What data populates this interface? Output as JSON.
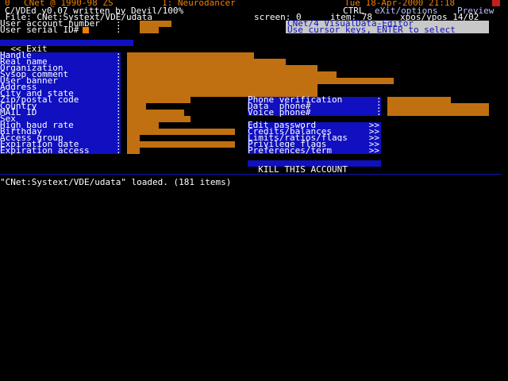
{
  "titlebar": {
    "port": "0",
    "system": "CNet @ 1990-98 ZS",
    "node": "1: Neurodancer",
    "datetime": "Tue 18-Apr-2000 21:18"
  },
  "header": {
    "line1": "C/VDEd v0.07 written by Devil/100%",
    "ctrl": "CTRL ",
    "exit_opts": "eXit/options ",
    "preview": "Preview",
    "file_line": " File: CNet:Systext/VDE/udata",
    "screen_label": "screen: 0",
    "item_label": "item: 78",
    "pos_label": "xpos/ypos 14/02",
    "help1": "CNet/4 VisualData-Editor",
    "help2": "Use cursor keys, ENTER to select"
  },
  "top_fields": [
    {
      "label": "User account number",
      "colon": ":"
    },
    {
      "label": "User serial ID#",
      "colon": ":"
    }
  ],
  "exit_label": "<< Exit",
  "fields": [
    {
      "label": "Handle",
      "colon": ":"
    },
    {
      "label": "Real name",
      "colon": ":"
    },
    {
      "label": "Organization",
      "colon": ":"
    },
    {
      "label": "Sysop comment",
      "colon": ":"
    },
    {
      "label": "User banner",
      "colon": ":"
    },
    {
      "label": "Address",
      "colon": ":"
    },
    {
      "label": "City and state",
      "colon": ":"
    },
    {
      "label": "Zip/postal code",
      "colon": ":"
    },
    {
      "label": "Country",
      "colon": ":"
    },
    {
      "label": "MAIL ID",
      "colon": ":"
    },
    {
      "label": "Sex",
      "colon": ":"
    },
    {
      "label": "High baud rate",
      "colon": ":"
    },
    {
      "label": "Birthday",
      "colon": ":"
    },
    {
      "label": "Access group",
      "colon": ":"
    },
    {
      "label": "Expiration date",
      "colon": ":"
    },
    {
      "label": "Expiration access",
      "colon": ":"
    }
  ],
  "phone_fields": [
    {
      "label": "Phone verification",
      "colon": ":"
    },
    {
      "label": "Data  phone#",
      "colon": ":"
    },
    {
      "label": "Voice phone#",
      "colon": ":"
    }
  ],
  "menu": [
    {
      "label": "Edit password",
      "arrows": ">>"
    },
    {
      "label": "Credits/balances",
      "arrows": ">>"
    },
    {
      "label": "Limits/ratios/flags",
      "arrows": ">>"
    },
    {
      "label": "Privilege flags",
      "arrows": ">>"
    },
    {
      "label": "Preferences/term",
      "arrows": ">>"
    }
  ],
  "kill_label": "KILL THIS ACCOUNT",
  "status": "\"CNet:Systext/VDE/udata\" loaded. (181 items)",
  "colors": {
    "background": "#000000",
    "panel": "#1010c0",
    "field_fill": "#c07010",
    "title_text": "#f08000",
    "text": "#ffffff"
  }
}
